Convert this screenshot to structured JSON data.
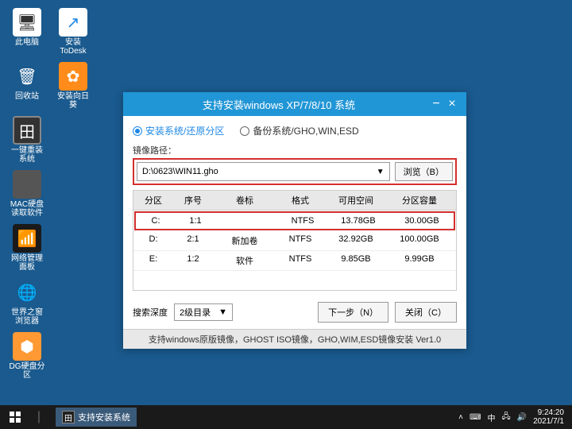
{
  "desktop": {
    "icons": [
      {
        "label": "此电脑"
      },
      {
        "label": "安装ToDesk"
      },
      {
        "label": "回收站"
      },
      {
        "label": "安装向日葵"
      },
      {
        "label": "一键重装系统"
      },
      {
        "label": "MAC硬盘读取软件"
      },
      {
        "label": "网络管理面板"
      },
      {
        "label": "世界之窗浏览器"
      },
      {
        "label": "DG硬盘分区"
      }
    ]
  },
  "window": {
    "title": "支持安装windows XP/7/8/10 系统",
    "radio1": "安装系统/还原分区",
    "radio2": "备份系统/GHO,WIN,ESD",
    "image_path_label": "镜像路径：",
    "path_value": "D:\\0623\\WIN11.gho",
    "browse": "浏览（B）",
    "headers": [
      "分区",
      "序号",
      "卷标",
      "格式",
      "可用空间",
      "分区容量"
    ],
    "rows": [
      {
        "drive": "C:",
        "idx": "1:1",
        "vol": "",
        "fmt": "NTFS",
        "free": "13.78GB",
        "cap": "30.00GB",
        "hl": true
      },
      {
        "drive": "D:",
        "idx": "2:1",
        "vol": "新加卷",
        "fmt": "NTFS",
        "free": "32.92GB",
        "cap": "100.00GB",
        "hl": false
      },
      {
        "drive": "E:",
        "idx": "1:2",
        "vol": "软件",
        "fmt": "NTFS",
        "free": "9.85GB",
        "cap": "9.99GB",
        "hl": false
      }
    ],
    "search_depth_label": "搜索深度",
    "search_depth_value": "2级目录",
    "next": "下一步（N）",
    "close": "关闭（C）",
    "footer": "支持windows原版镜像，GHOST ISO镜像，GHO,WIM,ESD镜像安装 Ver1.0"
  },
  "taskbar": {
    "app": "支持安装系统",
    "time": "9:24:20",
    "date": "2021/7/1"
  }
}
